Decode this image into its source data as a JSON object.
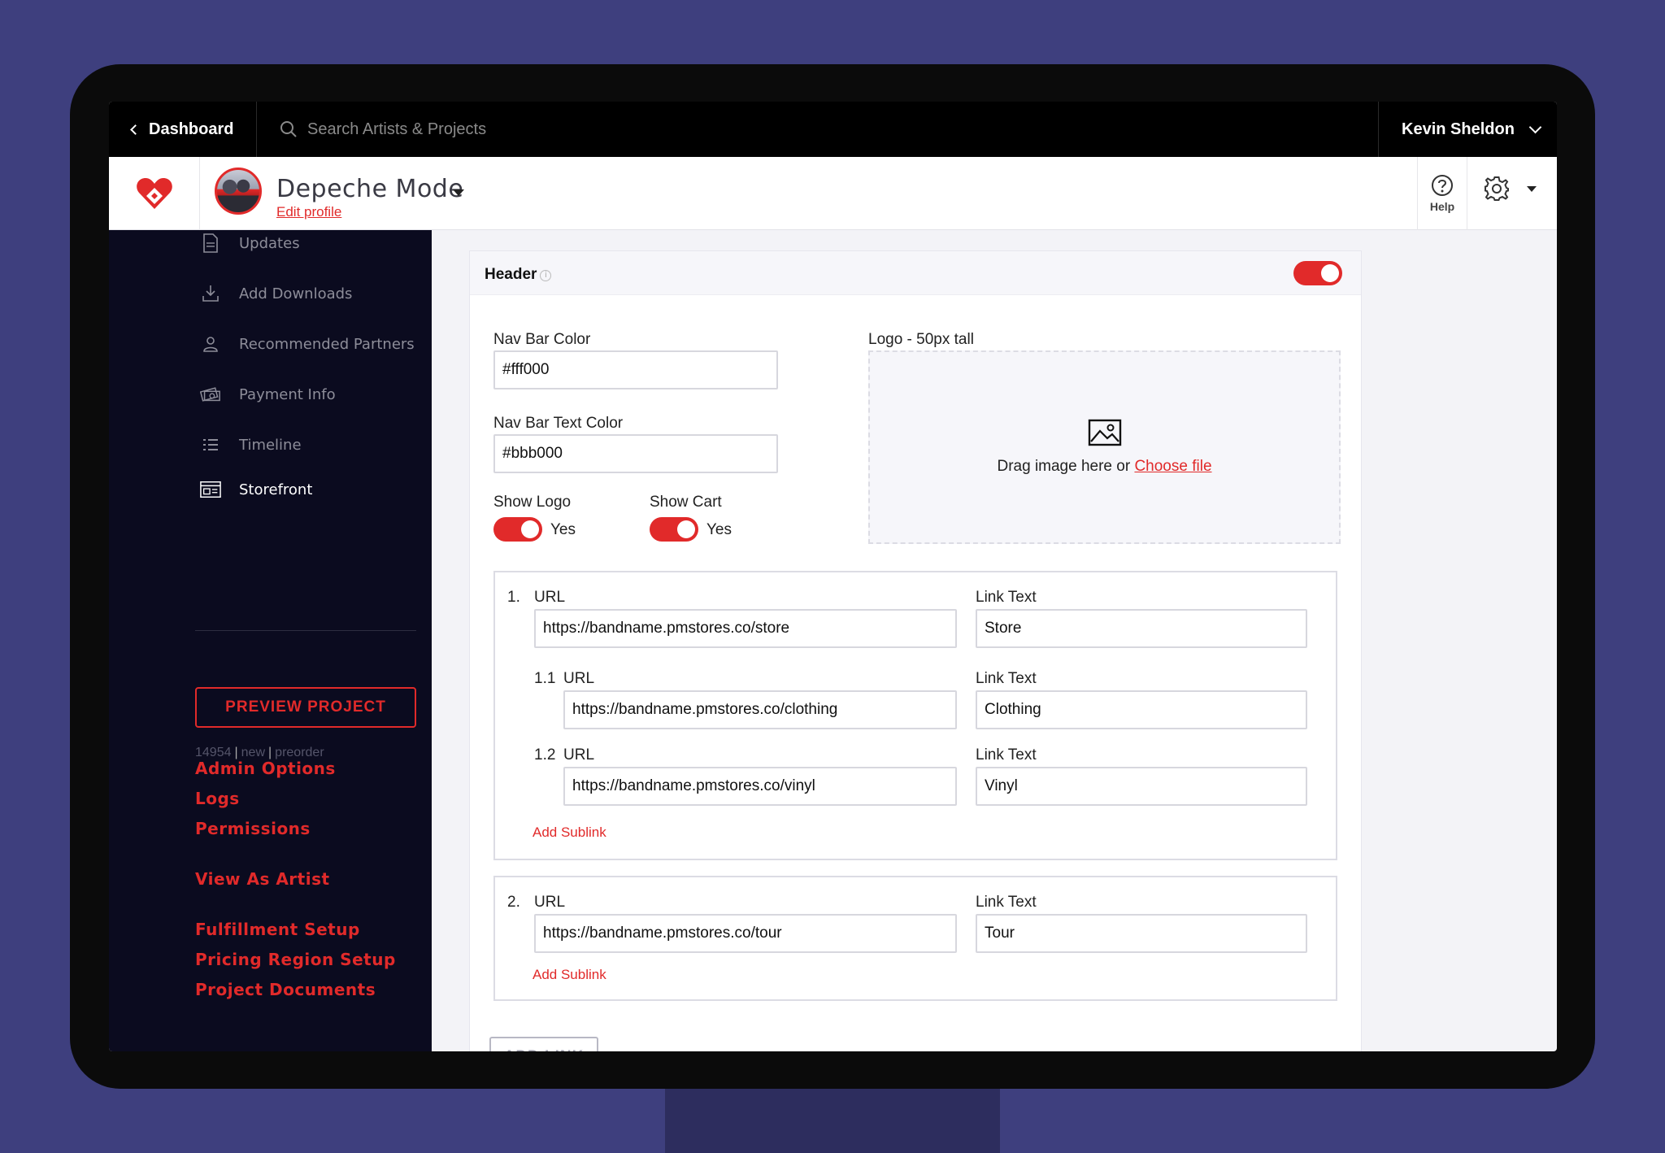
{
  "topbar": {
    "dashboard_label": "Dashboard",
    "search_placeholder": "Search Artists & Projects",
    "user_name": "Kevin Sheldon"
  },
  "header": {
    "artist_name": "Depeche Mode",
    "edit_profile": "Edit profile",
    "help_label": "Help"
  },
  "sidebar": {
    "nav": [
      {
        "label": "Updates",
        "icon": "document-icon"
      },
      {
        "label": "Add Downloads",
        "icon": "download-icon"
      },
      {
        "label": "Recommended Partners",
        "icon": "person-icon"
      },
      {
        "label": "Payment Info",
        "icon": "money-icon"
      },
      {
        "label": "Timeline",
        "icon": "list-icon"
      },
      {
        "label": "Storefront",
        "icon": "storefront-icon",
        "active": true
      }
    ],
    "preview_button": "PREVIEW PROJECT",
    "project_id": "14954",
    "project_status": "new",
    "project_type": "preorder",
    "links": {
      "admin_options": "Admin Options",
      "logs": "Logs",
      "permissions": "Permissions",
      "view_as_artist": "View As Artist",
      "fulfillment_setup": "Fulfillment Setup",
      "pricing_region_setup": "Pricing Region Setup",
      "project_documents": "Project Documents"
    }
  },
  "panel": {
    "title": "Header",
    "enabled": true,
    "nav_bar_color_label": "Nav Bar Color",
    "nav_bar_color_value": "#fff000",
    "nav_bar_text_color_label": "Nav Bar Text Color",
    "nav_bar_text_color_value": "#bbb000",
    "show_logo_label": "Show Logo",
    "show_logo_value": "Yes",
    "show_cart_label": "Show Cart",
    "show_cart_value": "Yes",
    "logo_label": "Logo - 50px tall",
    "dropzone_text": "Drag image here or ",
    "dropzone_link": "Choose file",
    "url_label": "URL",
    "link_text_label": "Link Text",
    "add_sublink": "Add Sublink",
    "add_link": "ADD LINK",
    "links": [
      {
        "num": "1.",
        "url": "https://bandname.pmstores.co/store",
        "text": "Store",
        "sublinks": [
          {
            "num": "1.1",
            "url": "https://bandname.pmstores.co/clothing",
            "text": "Clothing"
          },
          {
            "num": "1.2",
            "url": "https://bandname.pmstores.co/vinyl",
            "text": "Vinyl"
          }
        ]
      },
      {
        "num": "2.",
        "url": "https://bandname.pmstores.co/tour",
        "text": "Tour",
        "sublinks": []
      }
    ]
  },
  "colors": {
    "accent": "#e12a2a",
    "sidebar_bg": "#0b0b1f",
    "page_bg": "#3e3f7e"
  }
}
